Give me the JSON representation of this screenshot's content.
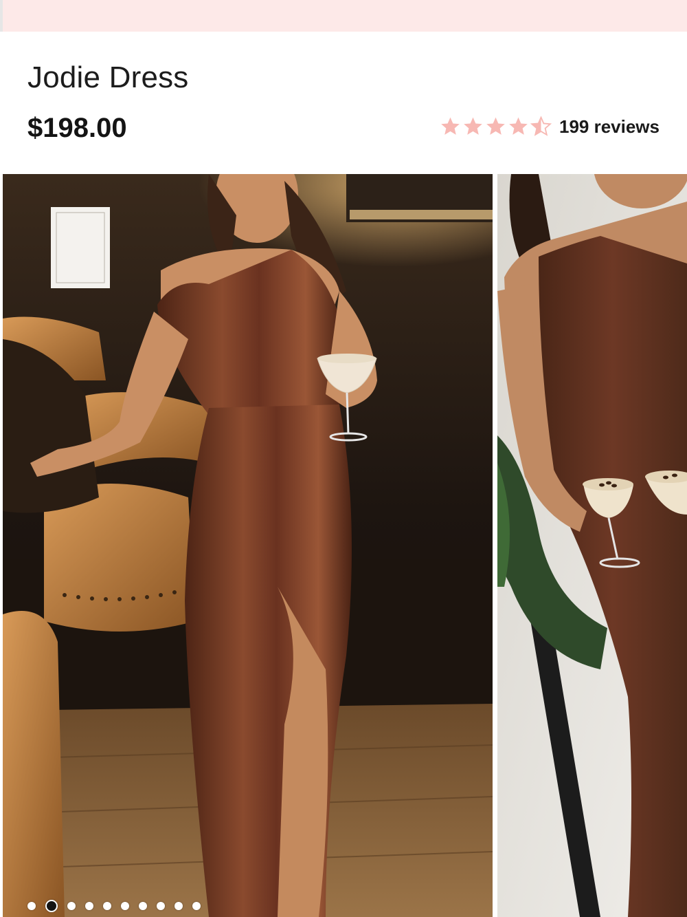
{
  "product": {
    "title": "Jodie Dress",
    "price": "$198.00"
  },
  "rating": {
    "value": 4.5,
    "max": 5,
    "star_color": "#f7b8b3",
    "reviews_label": "199 reviews"
  },
  "gallery": {
    "images": [
      {
        "name": "model-bar-lounge-photo",
        "alt": ""
      },
      {
        "name": "model-espresso-martini-photo",
        "alt": ""
      }
    ],
    "active_index": 1,
    "total_dots": 10
  },
  "colors": {
    "promo_strip": "#fde9e8",
    "text": "#1c1c1c",
    "dress": "#6a3220"
  }
}
